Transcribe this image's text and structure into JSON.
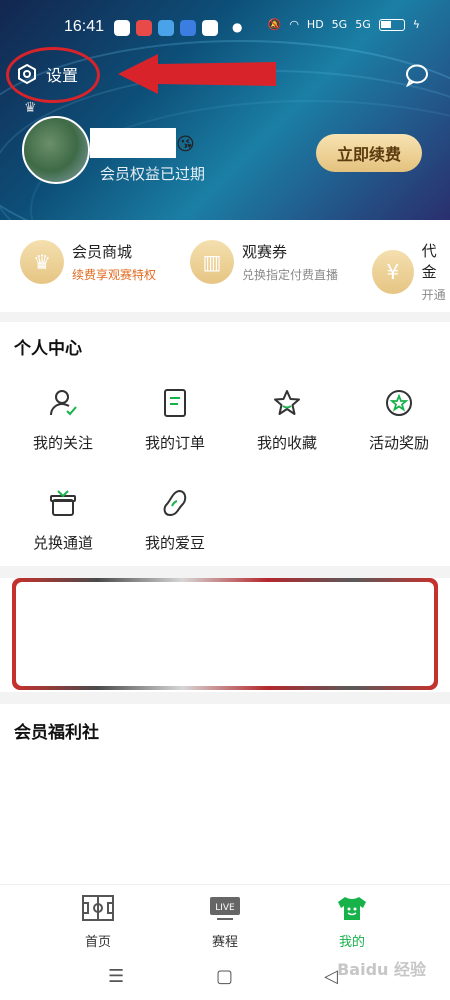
{
  "status_bar": {
    "time": "16:41",
    "net1": "HD",
    "net2": "5G",
    "net3": "5G"
  },
  "header": {
    "settings_label": "设置",
    "member_status": "会员权益已过期",
    "renew_button": "立即续费"
  },
  "benefits": [
    {
      "title": "会员商城",
      "subtitle": "续费享观赛特权",
      "icon": "crown-icon"
    },
    {
      "title": "观赛券",
      "subtitle": "兑换指定付费直播",
      "icon": "ticket-icon"
    },
    {
      "title": "代金",
      "subtitle": "开通",
      "icon": "coupon-icon"
    }
  ],
  "personal_center": {
    "title": "个人中心",
    "items": [
      {
        "label": "我的关注",
        "icon": "follow-icon"
      },
      {
        "label": "我的订单",
        "icon": "order-icon"
      },
      {
        "label": "我的收藏",
        "icon": "star-icon"
      },
      {
        "label": "活动奖励",
        "icon": "reward-icon"
      },
      {
        "label": "兑换通道",
        "icon": "gift-icon"
      },
      {
        "label": "我的爱豆",
        "icon": "bean-icon"
      }
    ]
  },
  "welfare": {
    "title": "会员福利社"
  },
  "bottom_nav": [
    {
      "label": "首页",
      "icon": "field-icon",
      "active": false
    },
    {
      "label": "赛程",
      "icon": "live-icon",
      "badge": "LIVE",
      "active": false
    },
    {
      "label": "我的",
      "icon": "jersey-icon",
      "active": true
    }
  ],
  "watermark": "Baidu 经验",
  "colors": {
    "accent_green": "#18b24b",
    "gold": "#e4c27e",
    "annotation_red": "#d8232a"
  }
}
